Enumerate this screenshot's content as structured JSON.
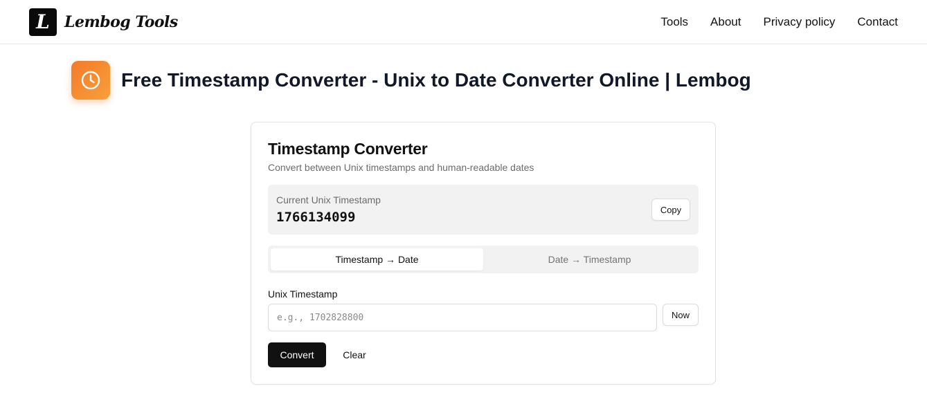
{
  "header": {
    "logo_glyph": "L",
    "brand": "Lembog Tools",
    "nav": [
      {
        "label": "Tools"
      },
      {
        "label": "About"
      },
      {
        "label": "Privacy policy"
      },
      {
        "label": "Contact"
      }
    ]
  },
  "page": {
    "title": "Free Timestamp Converter - Unix to Date Converter Online | Lembog",
    "icon": "clock-icon",
    "accent_color": "#f47a2a"
  },
  "card": {
    "title": "Timestamp Converter",
    "subtitle": "Convert between Unix timestamps and human-readable dates",
    "current": {
      "label": "Current Unix Timestamp",
      "value": "1766134099",
      "copy_label": "Copy"
    },
    "tabs": [
      {
        "label": "Timestamp → Date",
        "active": true
      },
      {
        "label": "Date → Timestamp",
        "active": false
      }
    ],
    "input": {
      "label": "Unix Timestamp",
      "value": "",
      "placeholder": "e.g., 1702828800",
      "now_label": "Now"
    },
    "actions": {
      "convert_label": "Convert",
      "clear_label": "Clear"
    }
  }
}
